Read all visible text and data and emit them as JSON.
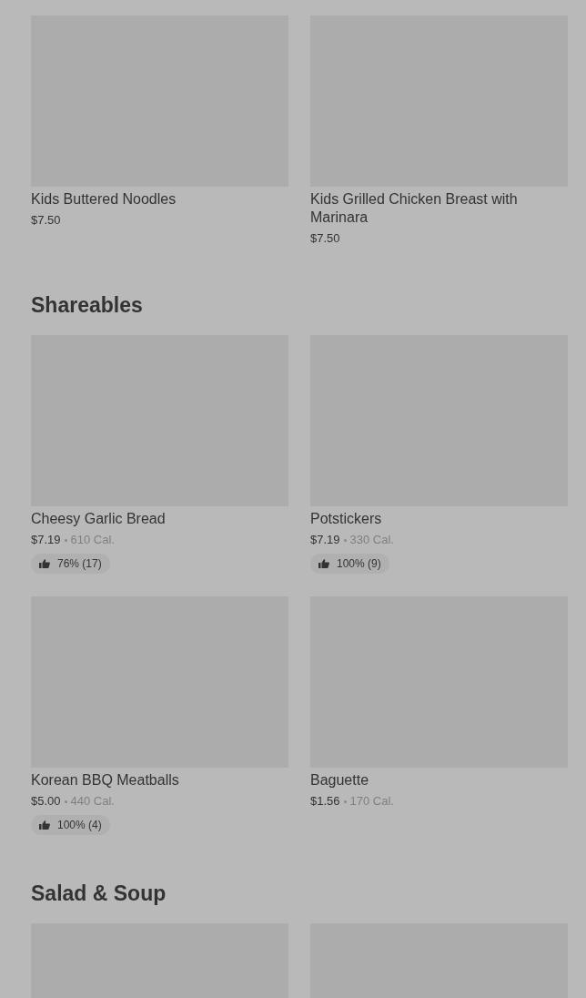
{
  "sections": [
    {
      "items": [
        {
          "kind": "picture",
          "name": "Kids Buttered Noodles",
          "price": "$7.50"
        },
        {
          "kind": "picture",
          "name": "Kids Grilled Chicken Breast with Marinara",
          "price": "$7.50"
        }
      ]
    },
    {
      "heading": "Shareables",
      "items": [
        {
          "kind": "picture",
          "name": "Cheesy Garlic Bread",
          "price": "$7.19",
          "calories": "610 Cal.",
          "rating": "76% (17)"
        },
        {
          "kind": "picture",
          "name": "Potstickers",
          "price": "$7.19",
          "calories": "330 Cal.",
          "rating": "100% (9)"
        },
        {
          "kind": "picture",
          "name": "Korean BBQ Meatballs",
          "price": "$5.00",
          "calories": "440 Cal.",
          "rating": "100% (4)"
        },
        {
          "kind": "picture",
          "name": "Baguette",
          "price": "$1.56",
          "calories": "170 Cal."
        }
      ]
    },
    {
      "heading": "Salad & Soup"
    }
  ]
}
